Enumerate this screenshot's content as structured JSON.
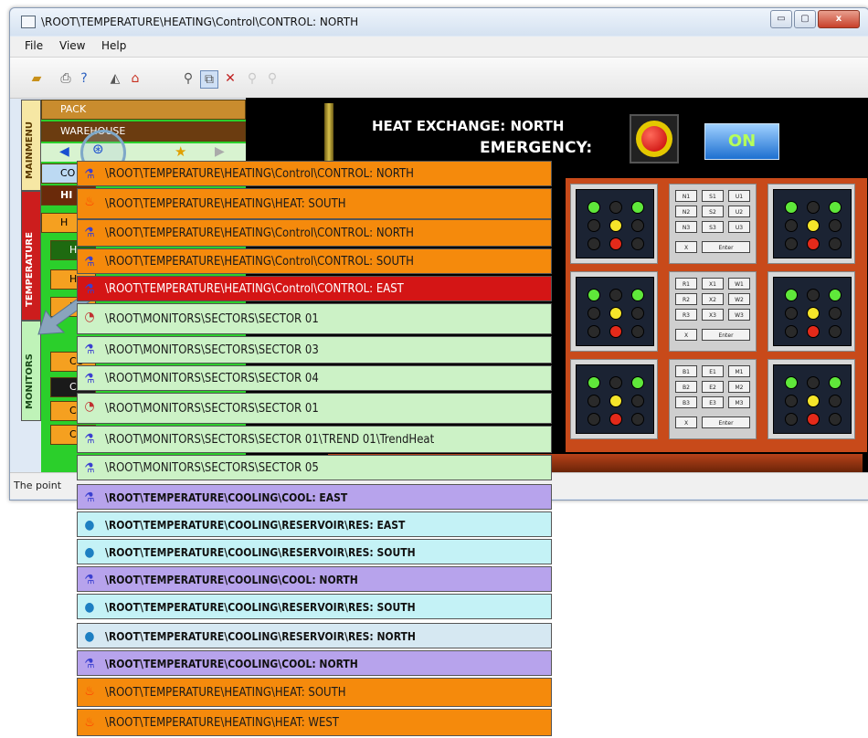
{
  "window": {
    "title": "\\ROOT\\TEMPERATURE\\HEATING\\Control\\CONTROL: NORTH",
    "controls": {
      "minimize": "▭",
      "maximize": "▢",
      "close": "x"
    }
  },
  "menu": [
    "File",
    "View",
    "Help"
  ],
  "toolbar": {
    "icons": [
      "open-folder-icon",
      "print-icon",
      "help-cursor-icon",
      "chart-icon",
      "home-icon",
      "search-icon",
      "zoom-window-icon",
      "zoom-fit-icon",
      "zoom-in-icon",
      "zoom-out-icon"
    ]
  },
  "sidebar": {
    "tabs": [
      "MAINMENU",
      "TEMPERATURE",
      "MONITORS"
    ],
    "tree": [
      {
        "label": "PACK"
      },
      {
        "label": "WAREHOUSE"
      },
      {
        "label": "CO"
      },
      {
        "label": "HI"
      },
      {
        "label": "H"
      },
      {
        "label": "H"
      },
      {
        "label": "H"
      },
      {
        "label": "H"
      },
      {
        "label": "CO"
      },
      {
        "label": "CO"
      },
      {
        "label": "CO"
      },
      {
        "label": "CO"
      }
    ]
  },
  "display": {
    "title": "HEAT EXCHANGE: NORTH",
    "emergency_label": "EMERGENCY:",
    "on_button": "ON",
    "keypads": [
      {
        "rows": [
          [
            "N1",
            "S1",
            "U1"
          ],
          [
            "N2",
            "S2",
            "U2"
          ],
          [
            "N3",
            "S3",
            "U3"
          ]
        ],
        "x_key": "X",
        "enter_key": "Enter"
      },
      {
        "rows": [
          [
            "R1",
            "X1",
            "W1"
          ],
          [
            "R2",
            "X2",
            "W2"
          ],
          [
            "R3",
            "X3",
            "W3"
          ]
        ],
        "x_key": "X",
        "enter_key": "Enter"
      },
      {
        "rows": [
          [
            "B1",
            "E1",
            "M1"
          ],
          [
            "B2",
            "E2",
            "M2"
          ],
          [
            "B3",
            "E3",
            "M3"
          ]
        ],
        "x_key": "X",
        "enter_key": "Enter"
      }
    ],
    "light_colors": {
      "green": "#5fe83a",
      "yellow": "#f5e52a",
      "red": "#e42a1a",
      "off": "#2a2a2a"
    }
  },
  "status": {
    "text": "The point"
  },
  "popup": [
    {
      "label": "\\ROOT\\TEMPERATURE\\HEATING\\Control\\CONTROL: NORTH",
      "icon": "flask-icon",
      "style": "orange"
    },
    {
      "label": "\\ROOT\\TEMPERATURE\\HEATING\\HEAT: SOUTH",
      "icon": "flame-icon",
      "style": "orange"
    },
    {
      "label": "\\ROOT\\TEMPERATURE\\HEATING\\Control\\CONTROL: NORTH",
      "icon": "flask-icon",
      "style": "orange"
    },
    {
      "label": "\\ROOT\\TEMPERATURE\\HEATING\\Control\\CONTROL: SOUTH",
      "icon": "flask-icon",
      "style": "orange"
    },
    {
      "label": "\\ROOT\\TEMPERATURE\\HEATING\\Control\\CONTROL: EAST",
      "icon": "flask-icon",
      "style": "red"
    },
    {
      "label": "\\ROOT\\MONITORS\\SECTORS\\SECTOR 01",
      "icon": "gauge-icon",
      "style": "green"
    },
    {
      "label": "\\ROOT\\MONITORS\\SECTORS\\SECTOR 03",
      "icon": "flask-icon",
      "style": "green"
    },
    {
      "label": "\\ROOT\\MONITORS\\SECTORS\\SECTOR 04",
      "icon": "flask-icon",
      "style": "green"
    },
    {
      "label": "\\ROOT\\MONITORS\\SECTORS\\SECTOR 01",
      "icon": "gauge-icon",
      "style": "green"
    },
    {
      "label": "\\ROOT\\MONITORS\\SECTORS\\SECTOR 01\\TREND 01\\TrendHeat",
      "icon": "flask-icon",
      "style": "green"
    },
    {
      "label": "\\ROOT\\MONITORS\\SECTORS\\SECTOR 05",
      "icon": "flask-icon",
      "style": "green"
    },
    {
      "label": "\\ROOT\\TEMPERATURE\\COOLING\\COOL: EAST",
      "icon": "flask-icon",
      "style": "purple"
    },
    {
      "label": "\\ROOT\\TEMPERATURE\\COOLING\\RESERVOIR\\RES: EAST",
      "icon": "water-drop-icon",
      "style": "cyan"
    },
    {
      "label": "\\ROOT\\TEMPERATURE\\COOLING\\RESERVOIR\\RES: SOUTH",
      "icon": "water-drop-icon",
      "style": "cyan"
    },
    {
      "label": "\\ROOT\\TEMPERATURE\\COOLING\\COOL: NORTH",
      "icon": "flask-icon",
      "style": "purple"
    },
    {
      "label": "\\ROOT\\TEMPERATURE\\COOLING\\RESERVOIR\\RES: SOUTH",
      "icon": "water-drop-icon",
      "style": "cyan"
    },
    {
      "label": "\\ROOT\\TEMPERATURE\\COOLING\\RESERVOIR\\RES: NORTH",
      "icon": "water-drop-icon",
      "style": "ltblue"
    },
    {
      "label": "\\ROOT\\TEMPERATURE\\COOLING\\COOL: NORTH",
      "icon": "flask-icon",
      "style": "purple"
    },
    {
      "label": "\\ROOT\\TEMPERATURE\\HEATING\\HEAT: SOUTH",
      "icon": "flame-icon",
      "style": "orange"
    },
    {
      "label": "\\ROOT\\TEMPERATURE\\HEATING\\HEAT: WEST",
      "icon": "flame-icon",
      "style": "orange"
    }
  ]
}
